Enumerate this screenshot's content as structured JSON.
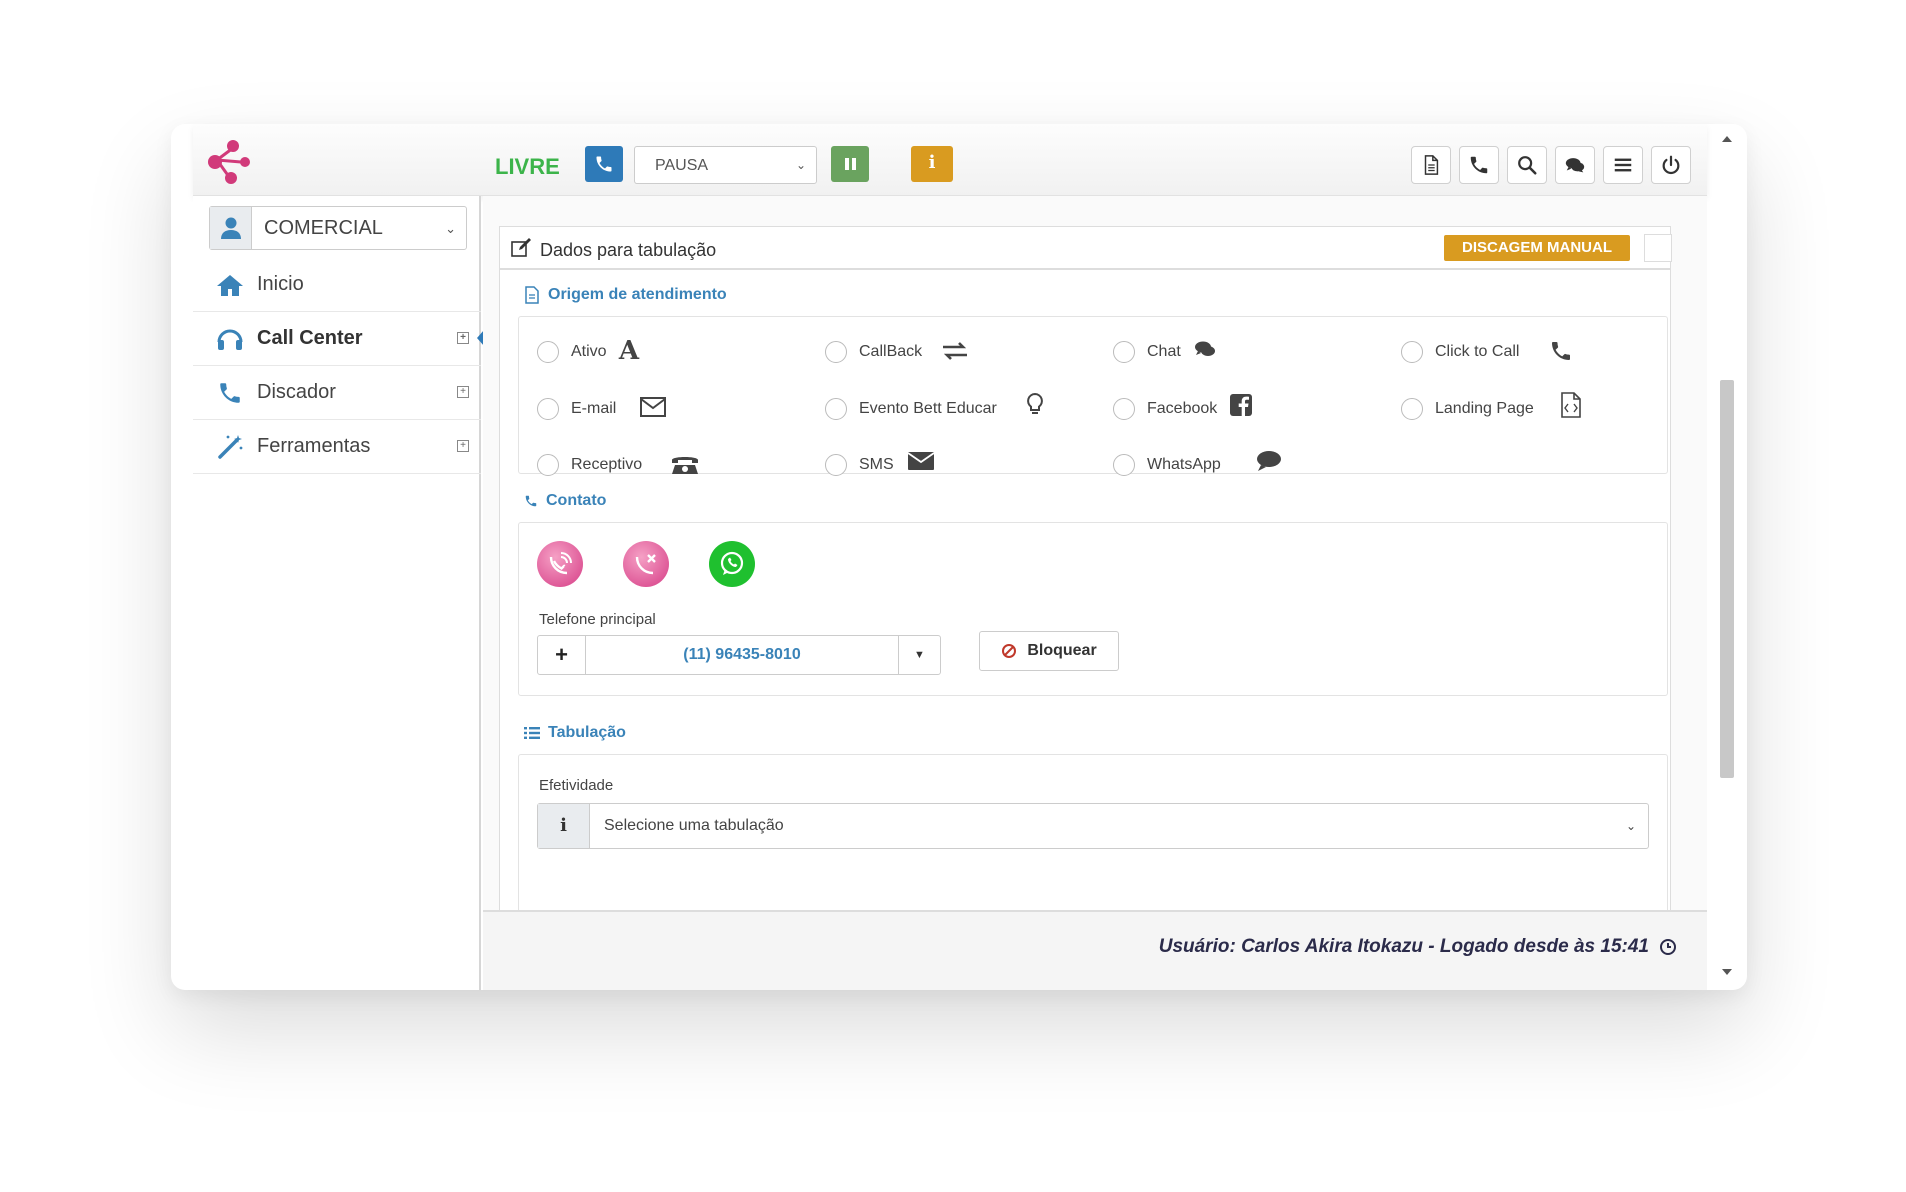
{
  "topbar": {
    "status": "LIVRE",
    "pause_select": "PAUSA",
    "info_label": "i",
    "tools": [
      {
        "name": "document-icon"
      },
      {
        "name": "phone-icon"
      },
      {
        "name": "search-icon"
      },
      {
        "name": "chat-icon"
      },
      {
        "name": "menu-icon"
      },
      {
        "name": "power-icon"
      }
    ]
  },
  "sidebar": {
    "department": "COMERCIAL",
    "items": [
      {
        "label": "Inicio",
        "icon": "home-icon"
      },
      {
        "label": "Call Center",
        "icon": "headset-icon"
      },
      {
        "label": "Discador",
        "icon": "phone-icon"
      },
      {
        "label": "Ferramentas",
        "icon": "magic-wand-icon"
      }
    ]
  },
  "panel": {
    "title": "Dados para tabulação",
    "discagem_label": "DISCAGEM MANUAL"
  },
  "origem": {
    "title": "Origem de atendimento",
    "options": [
      {
        "label": "Ativo",
        "icon": "letter-a-icon"
      },
      {
        "label": "CallBack",
        "icon": "exchange-icon"
      },
      {
        "label": "Chat",
        "icon": "chat-icon"
      },
      {
        "label": "Click to Call",
        "icon": "phone-icon"
      },
      {
        "label": "E-mail",
        "icon": "envelope-outline-icon"
      },
      {
        "label": "Evento Bett Educar",
        "icon": "lightbulb-icon"
      },
      {
        "label": "Facebook",
        "icon": "facebook-icon"
      },
      {
        "label": "Landing Page",
        "icon": "code-file-icon"
      },
      {
        "label": "Receptivo",
        "icon": "desk-phone-icon"
      },
      {
        "label": "SMS",
        "icon": "envelope-icon"
      },
      {
        "label": "WhatsApp",
        "icon": "speech-bubble-icon"
      }
    ]
  },
  "contato": {
    "title": "Contato",
    "phone_label": "Telefone principal",
    "phone_value": "(11) 96435-8010",
    "plus_label": "+",
    "block_label": "Bloquear"
  },
  "tabulacao": {
    "title": "Tabulação",
    "field_label": "Efetividade",
    "info_label": "i",
    "placeholder": "Selecione uma tabulação"
  },
  "footer": {
    "user_text": "Usuário: Carlos Akira Itokazu - Logado desde às 15:41"
  },
  "colors": {
    "brand": "#d13a7a",
    "accent_blue": "#3a83b8",
    "status_green": "#3cb44a",
    "warning": "#d99b20",
    "pause_green": "#6aa35f",
    "whatsapp": "#1fc02f"
  }
}
